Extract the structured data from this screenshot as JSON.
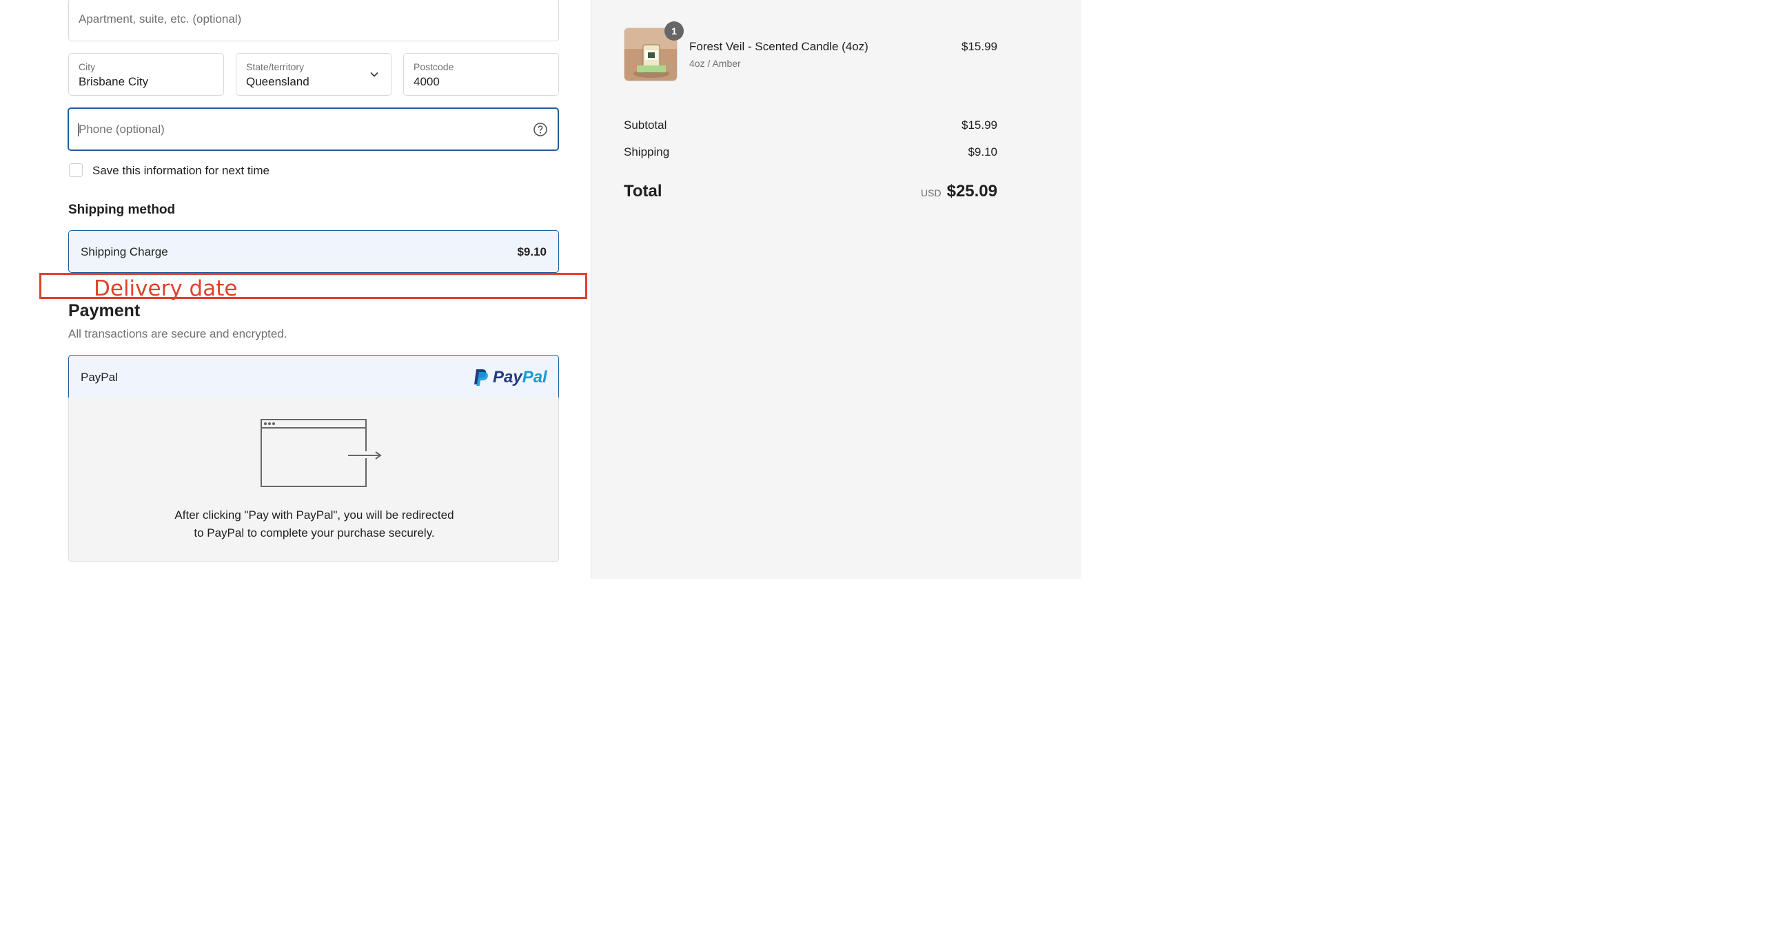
{
  "form": {
    "apartment_placeholder": "Apartment, suite, etc. (optional)",
    "city": {
      "label": "City",
      "value": "Brisbane City"
    },
    "state": {
      "label": "State/territory",
      "value": "Queensland"
    },
    "postcode": {
      "label": "Postcode",
      "value": "4000"
    },
    "phone_placeholder": "Phone (optional)",
    "save_info_label": "Save this information for next time"
  },
  "shipping": {
    "heading": "Shipping method",
    "option_name": "Shipping Charge",
    "option_price": "$9.10"
  },
  "annotation": {
    "text": "Delivery date",
    "color": "#e0412b"
  },
  "payment": {
    "heading": "Payment",
    "subtitle": "All transactions are secure and encrypted.",
    "method_name": "PayPal",
    "logo_word_1": "Pay",
    "logo_word_2": "Pal",
    "note_line1": "After clicking \"Pay with PayPal\", you will be redirected",
    "note_line2": "to PayPal to complete your purchase securely."
  },
  "summary": {
    "product": {
      "name": "Forest Veil - Scented Candle (4oz)",
      "variant": "4oz / Amber",
      "price": "$15.99",
      "quantity": "1"
    },
    "subtotal_label": "Subtotal",
    "subtotal": "$15.99",
    "shipping_label": "Shipping",
    "shipping": "$9.10",
    "total_label": "Total",
    "currency": "USD",
    "total": "$25.09"
  },
  "colors": {
    "accent": "#1f5c99",
    "selected_bg": "#f0f5fd",
    "sidebar_bg": "#f5f5f5"
  }
}
